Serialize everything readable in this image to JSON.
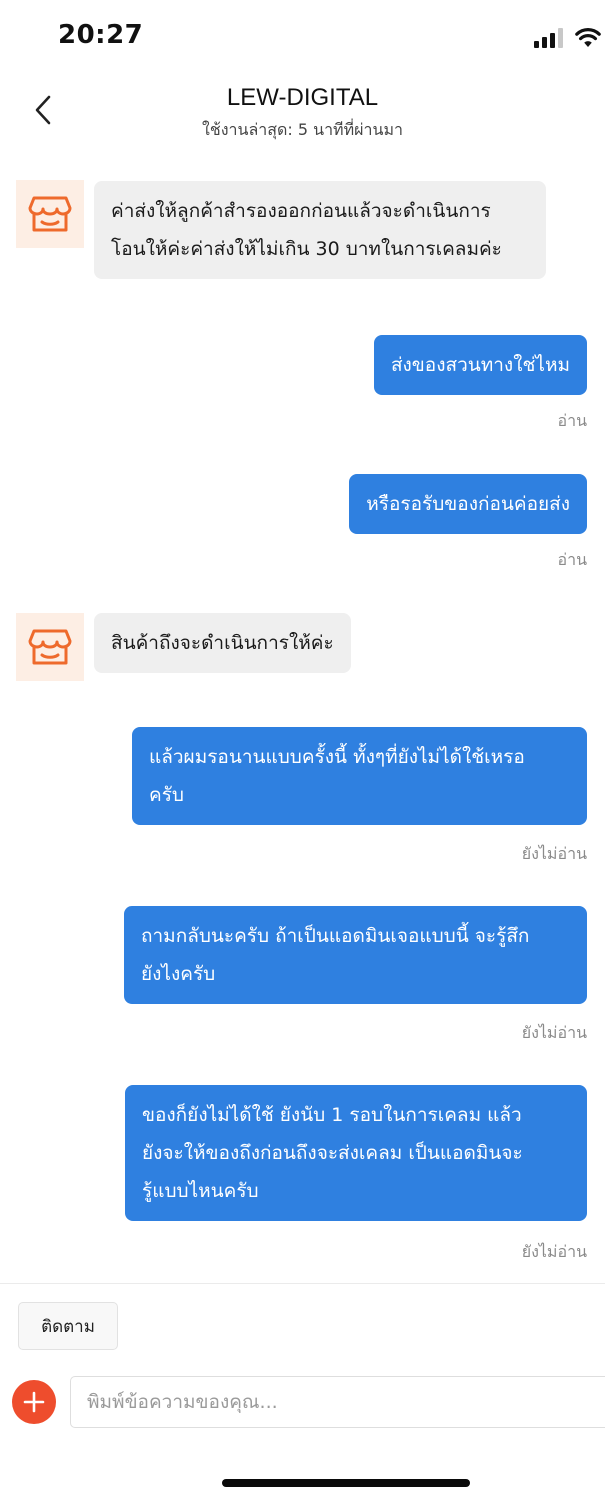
{
  "status_bar": {
    "time": "20:27"
  },
  "header": {
    "title": "LEW-DIGITAL",
    "subtitle": "ใช้งานล่าสุด: 5 นาทีที่ผ่านมา"
  },
  "messages": [
    {
      "from": "shop",
      "text": "ค่าส่งให้ลูกค้าสำรองออกก่อนแล้วจะดำเนินการ\nโอนให้ค่ะค่าส่งให้ไม่เกิน 30 บาทในการเคลมค่ะ",
      "status": ""
    },
    {
      "from": "me",
      "text": "ส่งของสวนทางใช่ไหม",
      "status": "อ่าน"
    },
    {
      "from": "me",
      "text": "หรือรอรับของก่อนค่อยส่ง",
      "status": "อ่าน"
    },
    {
      "from": "shop",
      "text": "สินค้าถึงจะดำเนินการให้ค่ะ",
      "status": ""
    },
    {
      "from": "me",
      "text": "แล้วผมรอนานแบบครั้งนี้ ทั้งๆที่ยังไม่ได้ใช้เหรอ\nครับ",
      "status": "ยังไม่อ่าน"
    },
    {
      "from": "me",
      "text": "ถามกลับนะครับ ถ้าเป็นแอดมินเจอแบบนี้ จะรู้สึก\nยังไงครับ",
      "status": "ยังไม่อ่าน"
    },
    {
      "from": "me",
      "text": "ของก็ยังไม่ได้ใช้ ยังนับ 1 รอบในการเคลม แล้ว\nยังจะให้ของถึงก่อนถึงจะส่งเคลม เป็นแอดมินจะ\nรู้แบบไหนครับ",
      "status": "ยังไม่อ่าน"
    }
  ],
  "bottom": {
    "follow_label": "ติดตาม",
    "input_placeholder": "พิมพ์ข้อความของคุณ...",
    "input_value": ""
  },
  "colors": {
    "outgoing_bubble": "#2f80e0",
    "incoming_bubble": "#efefef",
    "accent": "#ee4d2d",
    "shop_icon": "#ee6a2c"
  },
  "icons": {
    "back": "chevron-left-icon",
    "shop_avatar": "shop-icon",
    "add": "plus-icon",
    "signal": "signal-icon",
    "wifi": "wifi-icon"
  }
}
